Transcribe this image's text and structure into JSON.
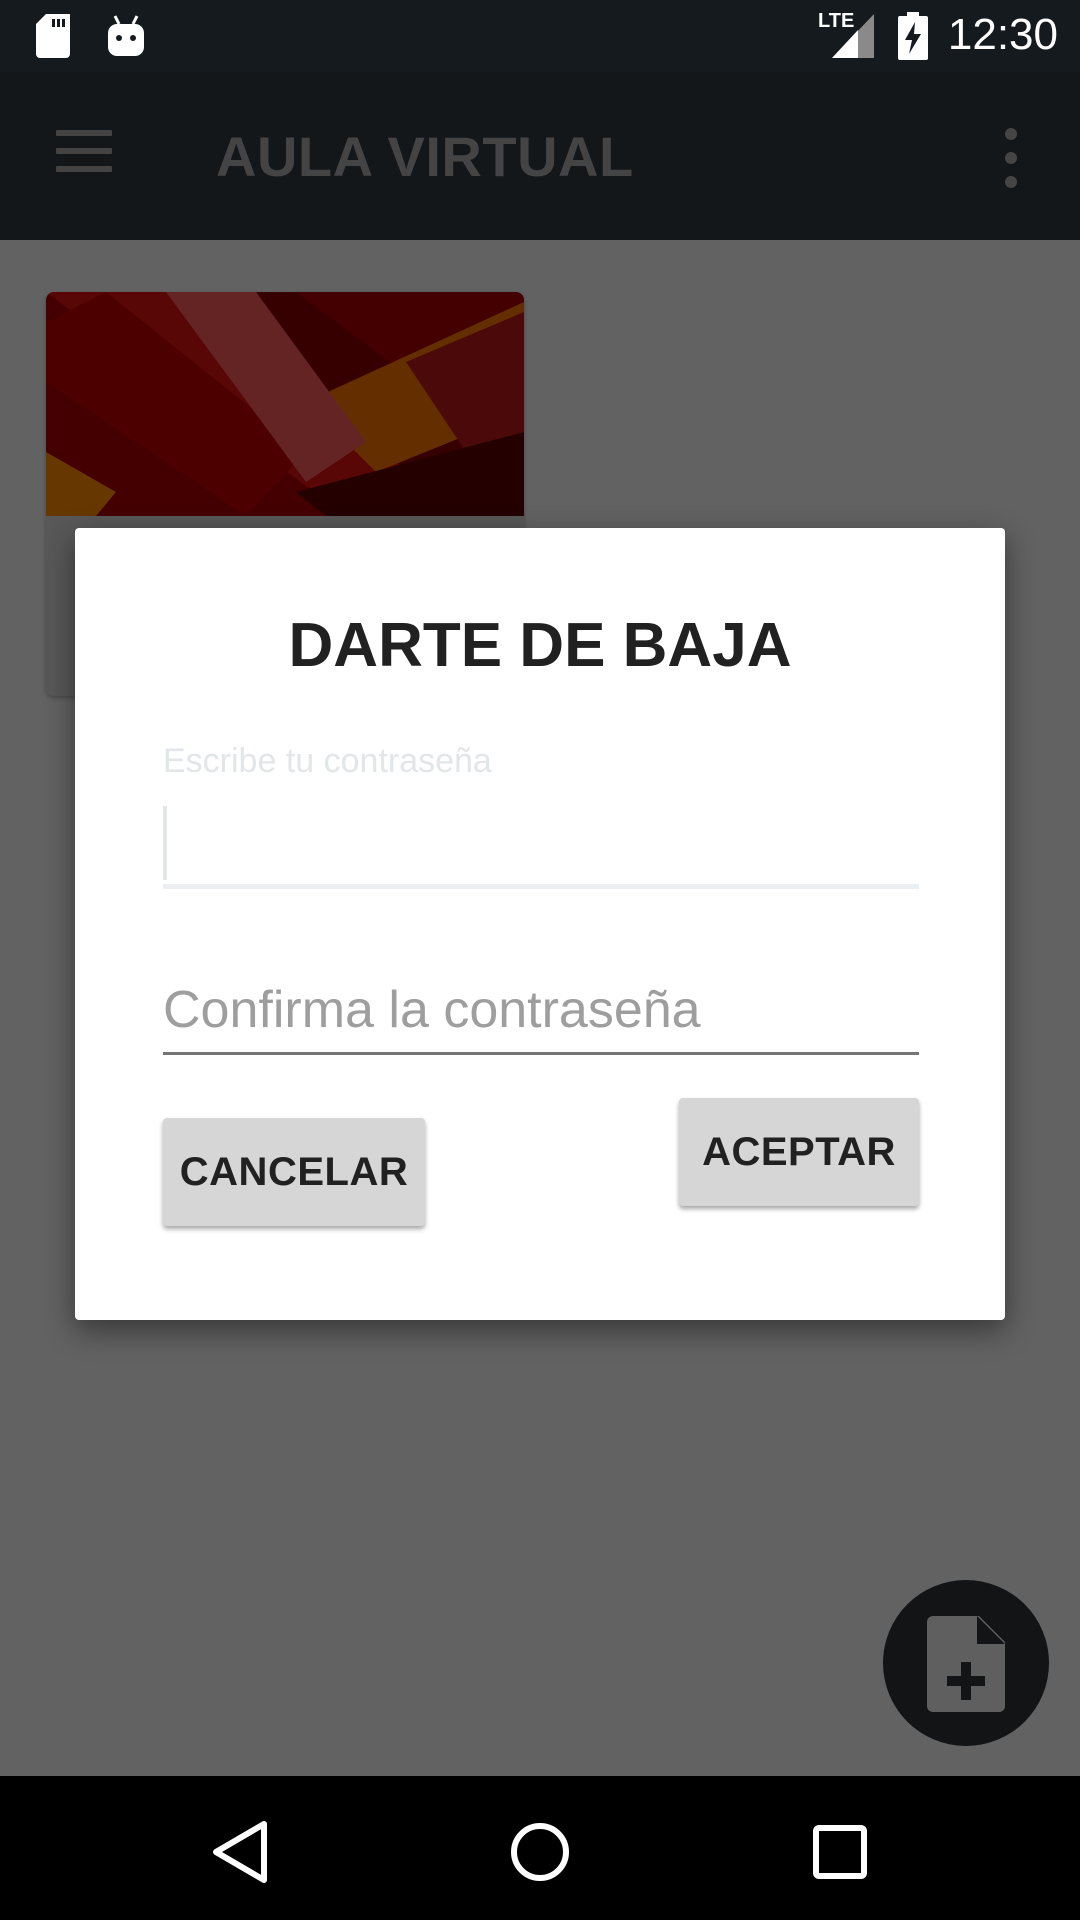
{
  "status_bar": {
    "time": "12:30",
    "network_label": "LTE",
    "icons": [
      "sd-card-icon",
      "android-debug-icon",
      "signal-icon",
      "battery-charging-icon"
    ]
  },
  "toolbar": {
    "title": "AULA VIRTUAL",
    "menu_icon": "hamburger-menu-icon",
    "overflow_icon": "more-vertical-icon"
  },
  "dialog": {
    "title": "DARTE DE BAJA",
    "password_label": "Escribe tu contraseña",
    "password_value": "",
    "confirm_placeholder": "Confirma la contraseña",
    "cancel_label": "CANCELAR",
    "accept_label": "ACEPTAR"
  },
  "fab": {
    "icon": "add-document-icon"
  },
  "nav_bar": {
    "icons": [
      "back-icon",
      "home-icon",
      "recents-icon"
    ]
  },
  "colors": {
    "status_bar": "#141a1e",
    "toolbar": "#1f262a",
    "dialog_bg": "#ffffff",
    "button_bg": "#d6d6d6",
    "card_art": "#8b0000"
  }
}
